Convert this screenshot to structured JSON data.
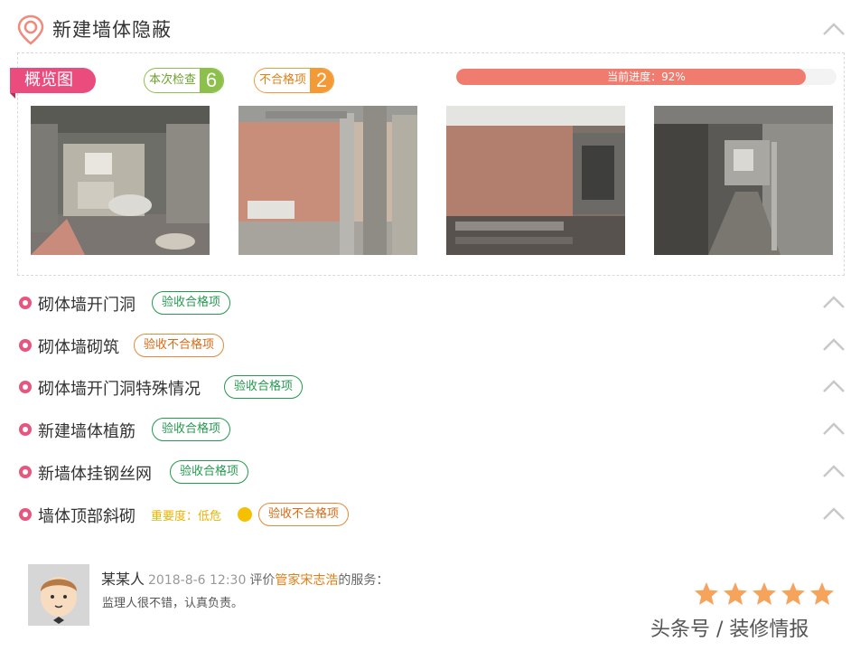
{
  "header": {
    "title": "新建墙体隐蔽"
  },
  "overview": {
    "tag_label": "概览图",
    "check_label": "本次检查",
    "check_count": "6",
    "fail_label": "不合格项",
    "fail_count": "2",
    "progress_text": "当前进度：92%",
    "progress_value": 0.92,
    "photos": [
      {
        "alt": "site-photo-1"
      },
      {
        "alt": "site-photo-2"
      },
      {
        "alt": "site-photo-3"
      },
      {
        "alt": "site-photo-4"
      }
    ]
  },
  "items": [
    {
      "title": "砌体墙开门洞",
      "badge": "验收合格项",
      "status": "pass"
    },
    {
      "title": "砌体墙砌筑",
      "badge": "验收不合格项",
      "status": "fail"
    },
    {
      "title": "砌体墙开门洞特殊情况",
      "badge": "验收合格项",
      "status": "pass"
    },
    {
      "title": "新建墙体植筋",
      "badge": "验收合格项",
      "status": "pass"
    },
    {
      "title": "新墙体挂钢丝网",
      "badge": "验收合格项",
      "status": "pass"
    },
    {
      "title": "墙体顶部斜砌",
      "importance": "重要度：低危",
      "badge": "验收不合格项",
      "status": "fail"
    }
  ],
  "review": {
    "reviewer": "某某人",
    "time": "2018-8-6 12:30",
    "verb": "评价",
    "manager": "管家宋志浩",
    "suffix": "的服务：",
    "comment": "监理人很不错，认真负责。",
    "rating": 5,
    "rating_max": 5
  },
  "watermark": "头条号 / 装修情报",
  "colors": {
    "accent_pink": "#ea4c7e",
    "pass_green": "#249a4e",
    "fail_orange": "#e58a3b",
    "progress": "#f07b6f",
    "star": "#f6a35c"
  }
}
